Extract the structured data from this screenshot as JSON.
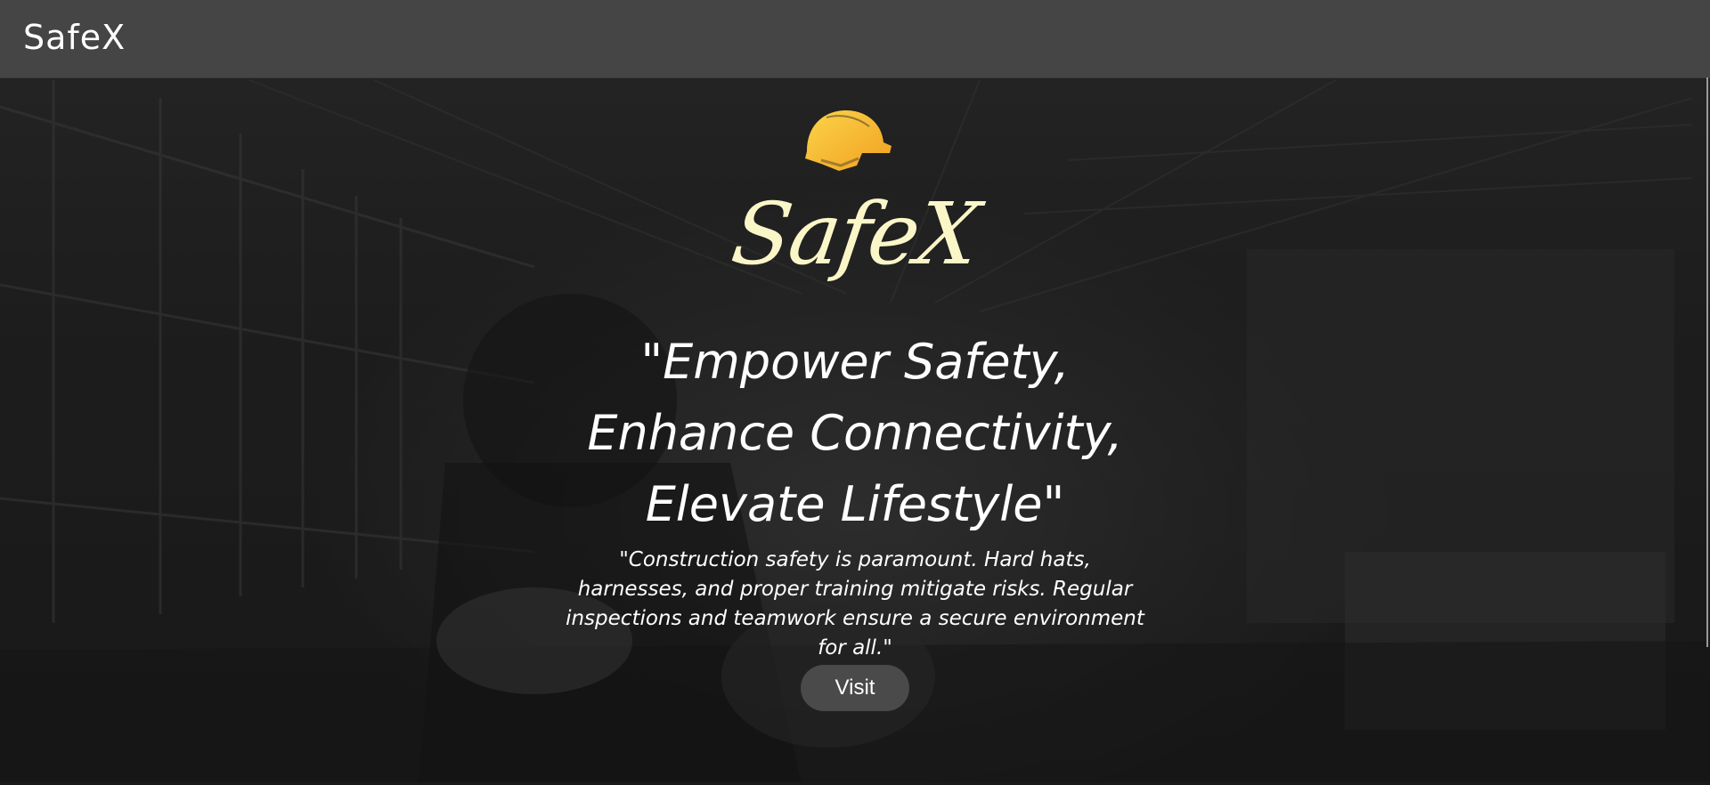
{
  "navbar": {
    "brand": "SafeX"
  },
  "hero": {
    "icon": "hard-hat-icon",
    "logo": "SafeX",
    "tagline_lines": [
      "\"Empower Safety,",
      "Enhance Connectivity,",
      "Elevate Lifestyle\""
    ],
    "quote": "\"Construction safety is paramount. Hard hats, harnesses, and proper training mitigate risks. Regular inspections and teamwork ensure a secure environment for all.\"",
    "button_label": "Visit"
  },
  "colors": {
    "navbar_bg": "#454545",
    "logo": "#fbf6c8",
    "helmet": "#f5b82e",
    "button_bg": "#4a4a4a"
  }
}
